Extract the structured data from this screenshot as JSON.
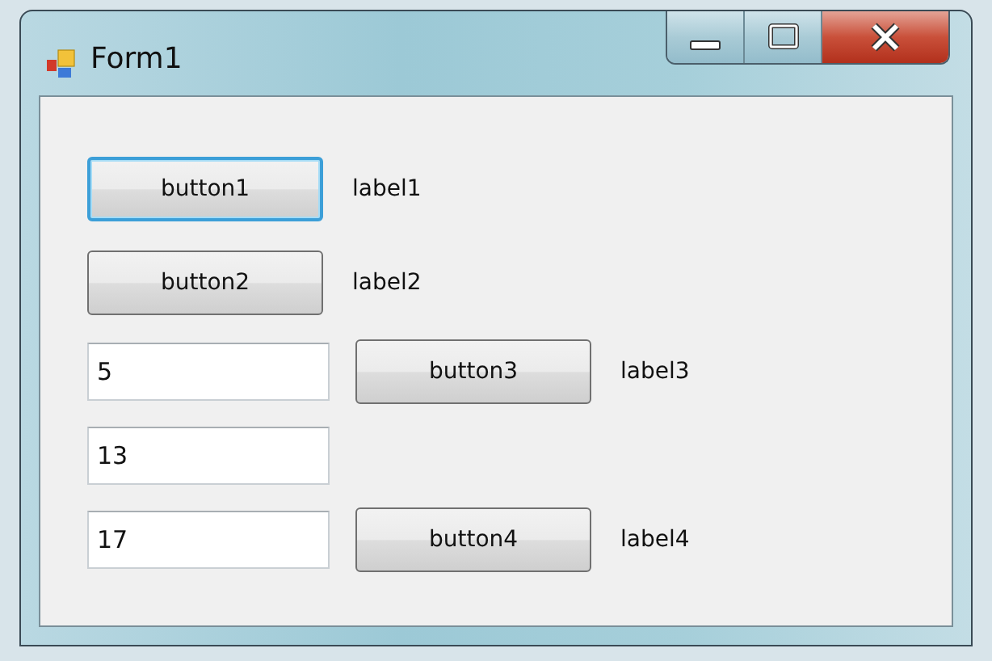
{
  "window": {
    "title": "Form1"
  },
  "rows": [
    {
      "items": [
        {
          "kind": "button",
          "text": "button1",
          "focused": true
        },
        {
          "kind": "label",
          "text": "label1"
        }
      ]
    },
    {
      "items": [
        {
          "kind": "button",
          "text": "button2",
          "focused": false
        },
        {
          "kind": "label",
          "text": "label2"
        }
      ]
    },
    {
      "items": [
        {
          "kind": "textbox",
          "value": "5"
        },
        {
          "kind": "button",
          "text": "button3",
          "focused": false
        },
        {
          "kind": "label",
          "text": "label3"
        }
      ]
    },
    {
      "items": [
        {
          "kind": "textbox",
          "value": "13"
        }
      ]
    },
    {
      "items": [
        {
          "kind": "textbox",
          "value": "17"
        },
        {
          "kind": "button",
          "text": "button4",
          "focused": false
        },
        {
          "kind": "label",
          "text": "label4"
        }
      ]
    }
  ]
}
